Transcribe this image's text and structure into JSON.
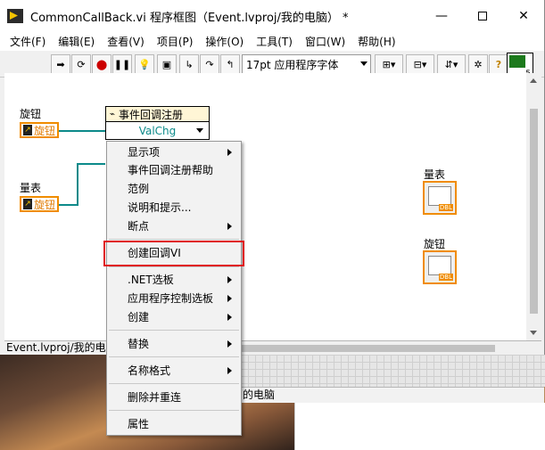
{
  "window": {
    "title": "CommonCallBack.vi 程序框图（Event.lvproj/我的电脑） *",
    "minimize": "—",
    "close": "✕"
  },
  "menubar": [
    "文件(F)",
    "编辑(E)",
    "查看(V)",
    "项目(P)",
    "操作(O)",
    "工具(T)",
    "窗口(W)",
    "帮助(H)"
  ],
  "toolbar": {
    "font_select": "17pt 应用程序字体",
    "vi_icon_digit": "5"
  },
  "diagram": {
    "knob_label": "旋钮",
    "knob_terminal": "旋钮",
    "gauge_label": "量表",
    "gauge_terminal": "旋钮",
    "event_node_title": "事件回调注册",
    "event_node_value": "ValChg",
    "right_gauge_label": "量表",
    "right_knob_label": "旋钮",
    "dbl": "DBL"
  },
  "statusbar": {
    "text": "Event.lvproj/我的电脑",
    "behind_text": "的电脑"
  },
  "context_menu": {
    "items": [
      {
        "label": "显示项",
        "submenu": true
      },
      {
        "label": "事件回调注册帮助",
        "submenu": false
      },
      {
        "label": "范例",
        "submenu": false
      },
      {
        "label": "说明和提示...",
        "submenu": false
      },
      {
        "label": "断点",
        "submenu": true
      },
      {
        "label": "创建回调VI",
        "submenu": false,
        "highlighted": true
      },
      {
        "label": ".NET选板",
        "submenu": true
      },
      {
        "label": "应用程序控制选板",
        "submenu": true
      },
      {
        "label": "创建",
        "submenu": true
      },
      {
        "label": "替换",
        "submenu": true
      },
      {
        "label": "名称格式",
        "submenu": true
      },
      {
        "label": "删除并重连",
        "submenu": false
      },
      {
        "label": "属性",
        "submenu": false
      }
    ]
  },
  "colors": {
    "terminal_orange": "#f08c00",
    "wire_teal": "#0c8a8a",
    "highlight_red": "#e0151b"
  }
}
